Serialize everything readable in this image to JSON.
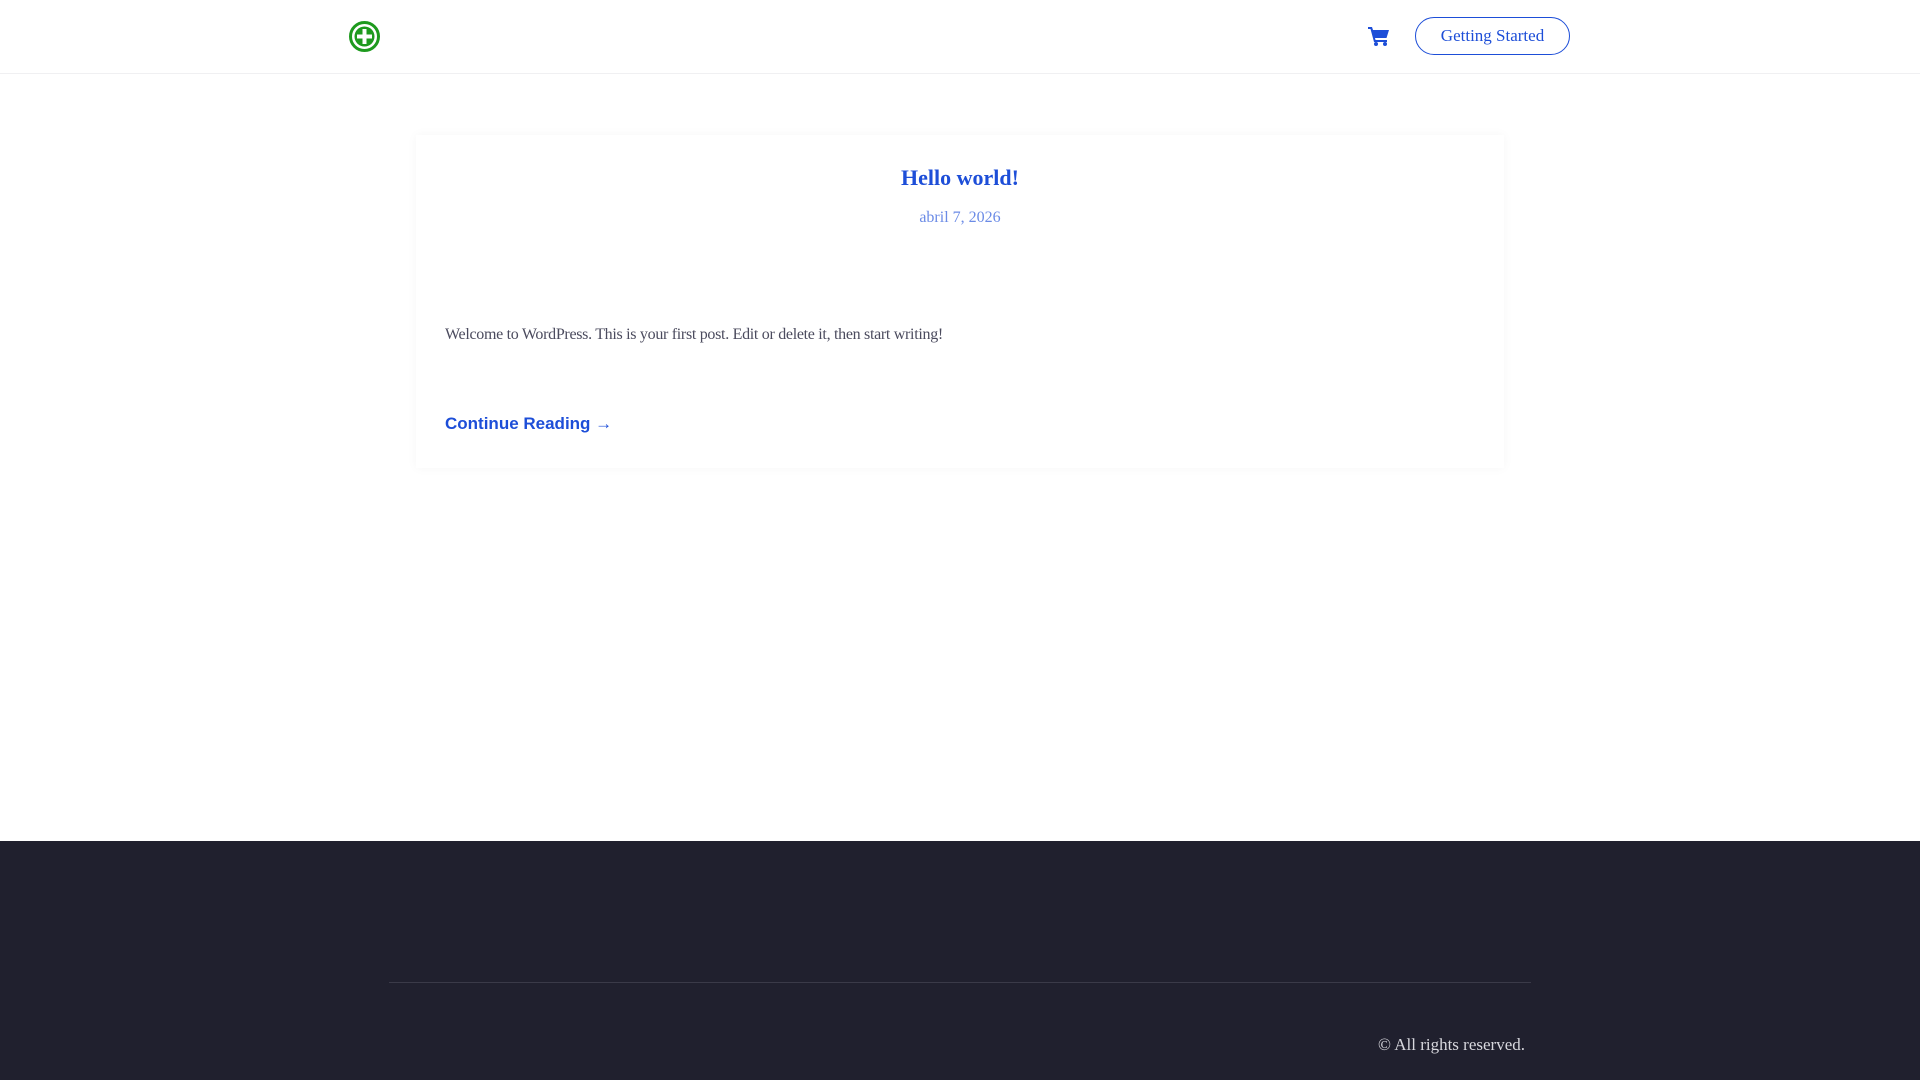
{
  "header": {
    "logo_alt": "green cross logo",
    "cart_icon": "shopping-cart-icon",
    "cta_label": "Getting Started"
  },
  "post": {
    "title": "Hello world!",
    "date": "abril 7, 2026",
    "excerpt": "Welcome to WordPress. This is your first post. Edit or delete it, then start writing!",
    "read_more": "Continue Reading →"
  },
  "footer": {
    "copyright": "© All rights reserved."
  },
  "colors": {
    "accent": "#1d4ed8",
    "logo_green": "#1e9a1e",
    "footer_bg": "#20202e"
  }
}
